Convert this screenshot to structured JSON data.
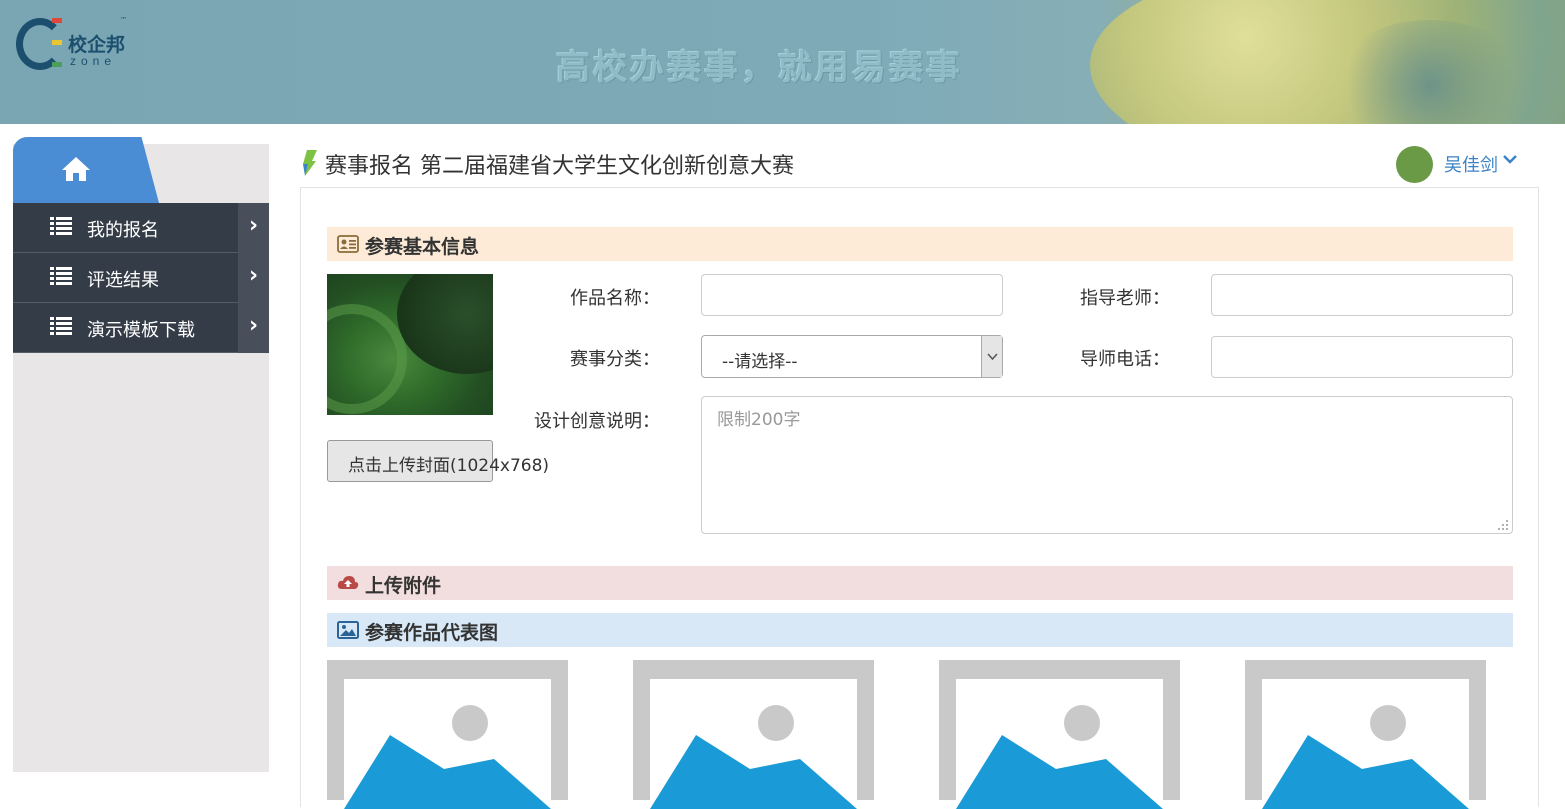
{
  "header": {
    "logo_text": "校企邦",
    "logo_sub": "zone",
    "logo_tm": "™",
    "slogan": "高校办赛事，就用易赛事"
  },
  "sidebar": {
    "home_icon": "home-icon",
    "items": [
      {
        "label": "我的报名",
        "icon": "list-icon",
        "arrow": "›"
      },
      {
        "label": "评选结果",
        "icon": "list-icon",
        "arrow": "›"
      },
      {
        "label": "演示模板下载",
        "icon": "list-icon",
        "arrow": "›"
      }
    ]
  },
  "main": {
    "title": "赛事报名 第二届福建省大学生文化创新创意大赛",
    "user_name": "吴佳剑",
    "sections": {
      "basic": "参赛基本信息",
      "upload": "上传附件",
      "representative": "参赛作品代表图"
    },
    "upload_cover_label": "点击上传封面(1024x768)",
    "form": {
      "work_name_label": "作品名称：",
      "work_name_value": "",
      "teacher_label": "指导老师：",
      "teacher_value": "",
      "category_label": "赛事分类：",
      "category_value": "--请选择--",
      "teacher_phone_label": "导师电话：",
      "teacher_phone_value": "",
      "description_label": "设计创意说明：",
      "description_placeholder": "限制200字"
    },
    "thumbnails": [
      "image-placeholder-icon",
      "image-placeholder-icon",
      "image-placeholder-icon",
      "image-placeholder-icon"
    ]
  },
  "colors": {
    "sidebar_dark": "#343c48",
    "accent_blue": "#4a8dd4",
    "link_blue": "#3a83c6",
    "section_basic_bg": "#fdebd8",
    "section_upload_bg": "#f2dede",
    "section_rep_bg": "#d9e8f7",
    "avatar_green": "#6b9a47"
  }
}
